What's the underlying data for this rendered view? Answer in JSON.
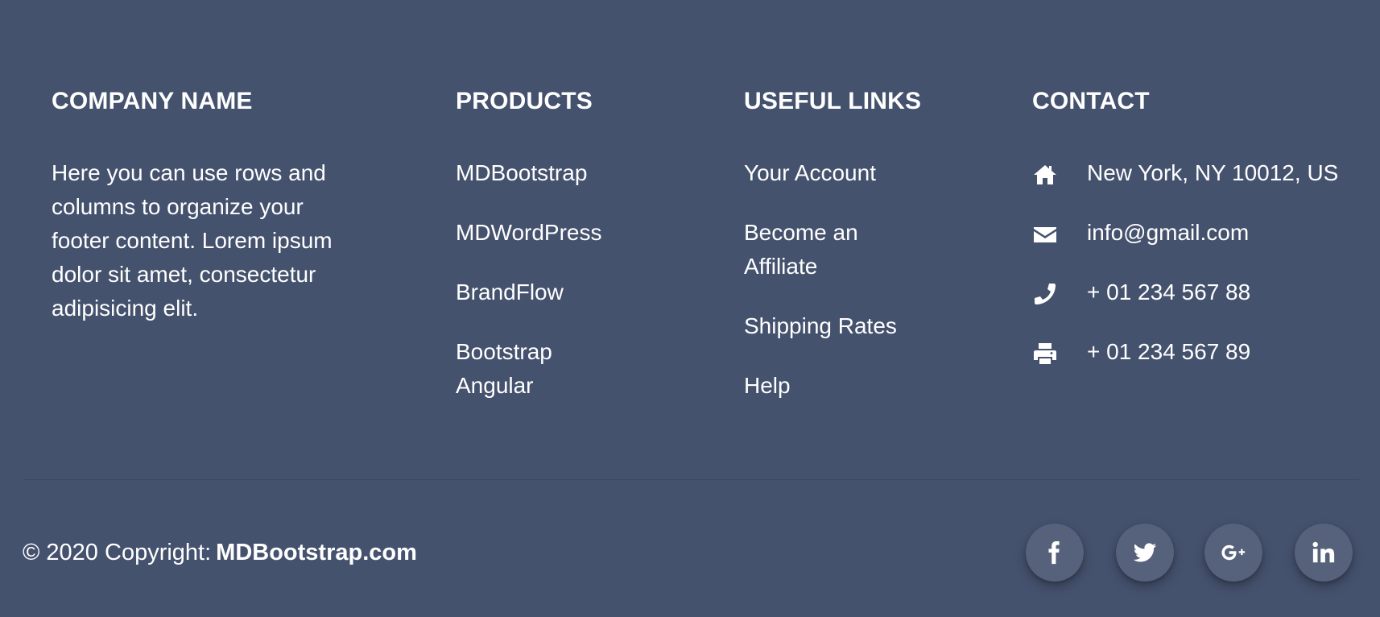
{
  "company": {
    "heading": "COMPANY NAME",
    "text": "Here you can use rows and columns to organize your footer content. Lorem ipsum dolor sit amet, consectetur adipisicing elit."
  },
  "products": {
    "heading": "PRODUCTS",
    "items": [
      "MDBootstrap",
      "MDWordPress",
      "BrandFlow",
      "Bootstrap Angular"
    ]
  },
  "useful_links": {
    "heading": "USEFUL LINKS",
    "items": [
      "Your Account",
      "Become an Affiliate",
      "Shipping Rates",
      "Help"
    ]
  },
  "contact": {
    "heading": "CONTACT",
    "items": [
      {
        "icon": "home-icon",
        "value": "New York, NY 10012, US"
      },
      {
        "icon": "envelope-icon",
        "value": "info@gmail.com"
      },
      {
        "icon": "phone-icon",
        "value": "+ 01 234 567 88"
      },
      {
        "icon": "print-icon",
        "value": "+ 01 234 567 89"
      }
    ]
  },
  "footer": {
    "copyright_prefix": "© 2020 Copyright:",
    "copyright_brand": "MDBootstrap.com"
  },
  "social": [
    {
      "icon": "facebook-icon",
      "label": "f"
    },
    {
      "icon": "twitter-icon",
      "label": "twitter"
    },
    {
      "icon": "google-plus-icon",
      "label": "G+"
    },
    {
      "icon": "linkedin-icon",
      "label": "in"
    }
  ],
  "colors": {
    "background": "#45526e",
    "text": "#ffffff",
    "social_button": "#56617c"
  }
}
